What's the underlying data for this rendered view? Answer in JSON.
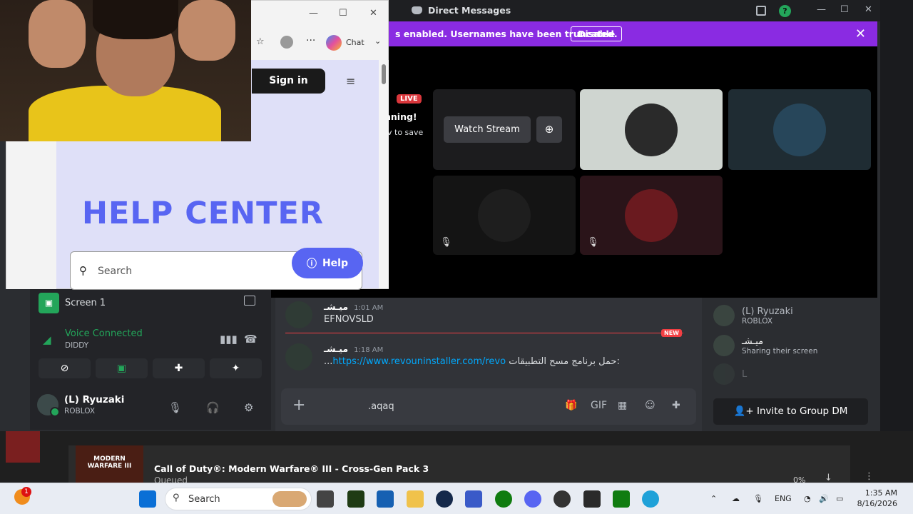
{
  "discord": {
    "window_title": "Direct Messages",
    "notice": {
      "text": "s enabled. Usernames have been truncated.",
      "button": "Disable"
    },
    "stage": {
      "live_badge": "LIVE",
      "partial_title": "nning!",
      "partial_sub": "v to save",
      "watch_stream": "Watch Stream"
    },
    "left_panel": {
      "screen_label": "Screen 1",
      "voice_status": "Voice Connected",
      "voice_channel": "DIDDY",
      "user_name": "(L) Ryuzaki",
      "user_status": "ROBLOX"
    },
    "chat": {
      "messages": [
        {
          "author": "ميـشـ",
          "time": "1:01 AM",
          "text": "EFNOVSLD"
        },
        {
          "author": "ميـشـ",
          "time": "1:18 AM",
          "link": "https://www.revouninstaller.com/revo",
          "text_rtl": "حمل برنامج مسح التطبيقات:",
          "ellipsis": "..."
        }
      ],
      "new_badge": "NEW",
      "input_value": ".aqaq"
    },
    "members": [
      {
        "name": "(L) Ryuzaki",
        "sub": "ROBLOX"
      },
      {
        "name": "ميـشـ",
        "sub": "Sharing their screen"
      },
      {
        "name": "L",
        "sub": ""
      }
    ],
    "invite_button": "Invite to Group DM"
  },
  "browser": {
    "chat_button": "Chat",
    "signin": "Sign in",
    "help_title": "HELP CENTER",
    "search_placeholder": "Search",
    "help_button": "Help"
  },
  "download": {
    "game_title": "Call of Duty®: Modern Warfare® III - Cross-Gen Pack 3",
    "status": "Queued",
    "percent": "0%",
    "thumb_text": "MODERN WARFARE III"
  },
  "taskbar": {
    "search_label": "Search",
    "language": "ENG",
    "time": "1:35 AM",
    "date": "8/16/2026",
    "notification_count": "1"
  }
}
